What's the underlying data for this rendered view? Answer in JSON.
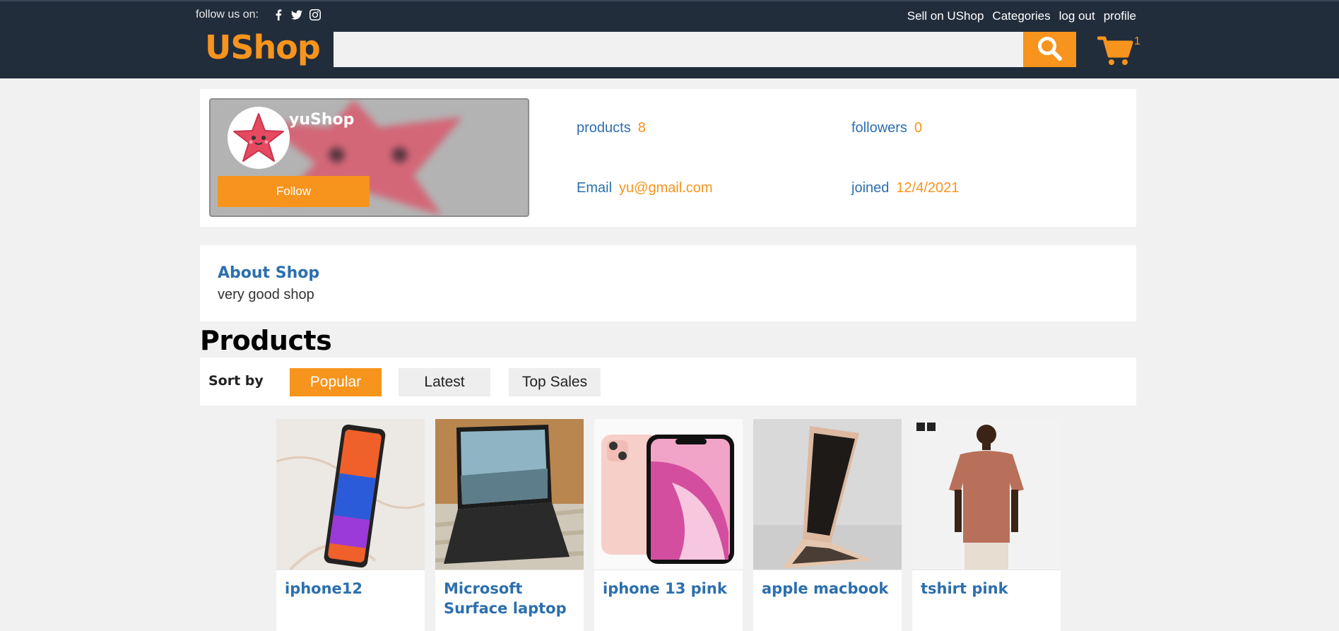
{
  "header": {
    "follow_text": "follow us on:",
    "social_icons": [
      "facebook-icon",
      "twitter-icon",
      "instagram-icon"
    ],
    "links": [
      "Sell on UShop",
      "Categories",
      "log out",
      "profile"
    ],
    "logo": "UShop",
    "search": {
      "value": "",
      "placeholder": ""
    },
    "cart_count": "1"
  },
  "shop": {
    "name": "yuShop",
    "follow_label": "Follow",
    "stats": {
      "products": {
        "label": "products",
        "value": "8"
      },
      "followers": {
        "label": "followers",
        "value": "0"
      },
      "email": {
        "label": "Email",
        "value": "yu@gmail.com"
      },
      "joined": {
        "label": "joined",
        "value": "12/4/2021"
      }
    }
  },
  "about": {
    "title": "About Shop",
    "text": "very good shop"
  },
  "products_section": {
    "heading": "Products",
    "sort_label": "Sort by",
    "sort_options": [
      "Popular",
      "Latest",
      "Top Sales"
    ],
    "active_sort": "Popular",
    "items": [
      {
        "name": "iphone12"
      },
      {
        "name": "Microsoft Surface laptop"
      },
      {
        "name": "iphone 13 pink"
      },
      {
        "name": "apple macbook"
      },
      {
        "name": "tshirt pink"
      }
    ]
  },
  "colors": {
    "header_bg": "#222d3c",
    "accent": "#f7941d",
    "link_blue": "#2c6fad",
    "page_bg": "#f1f1f1"
  }
}
